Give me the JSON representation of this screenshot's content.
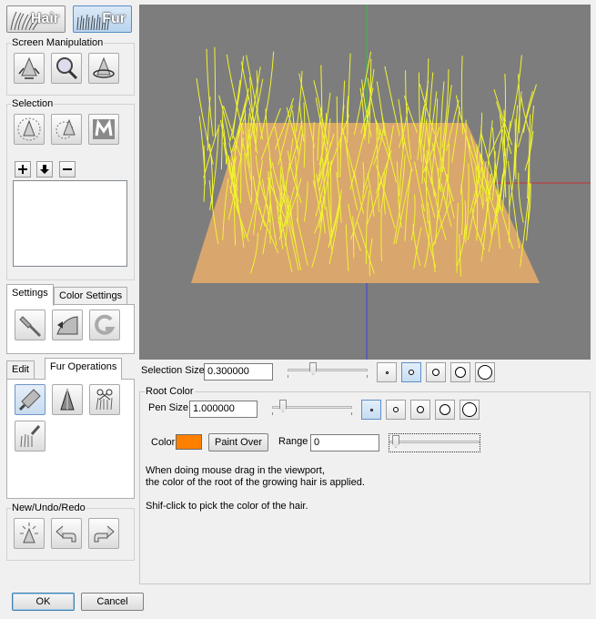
{
  "mode": {
    "hair_label": "Hair",
    "fur_label": "Fur"
  },
  "screen_manipulation": {
    "title": "Screen Manipulation"
  },
  "selection": {
    "title": "Selection"
  },
  "settings_tabs": {
    "settings": "Settings",
    "color_settings": "Color Settings"
  },
  "ops_tabs": {
    "edit": "Edit",
    "fur_operations": "Fur Operations"
  },
  "history": {
    "title": "New/Undo/Redo"
  },
  "selection_size": {
    "label": "Selection Size",
    "value": "0.300000",
    "slider_fraction": 0.3
  },
  "root_color": {
    "title": "Root Color",
    "pen_size_label": "Pen Size",
    "pen_size_value": "1.000000",
    "color_label": "Color",
    "color_value": "#ff7f00",
    "paint_over_label": "Paint Over",
    "range_label": "Range",
    "range_value": "0",
    "help_line1": "When doing mouse drag in the viewport,",
    "help_line2": "the color of the root of the growing hair is applied.",
    "help_line3": "Shif-click to pick the color of the hair."
  },
  "footer": {
    "ok_label": "OK",
    "cancel_label": "Cancel"
  },
  "colors": {
    "viewport_bg": "#7d7d7d",
    "plane": "#d9a66e",
    "hair": "#f2f52e",
    "accent": "#5e8fc7"
  }
}
